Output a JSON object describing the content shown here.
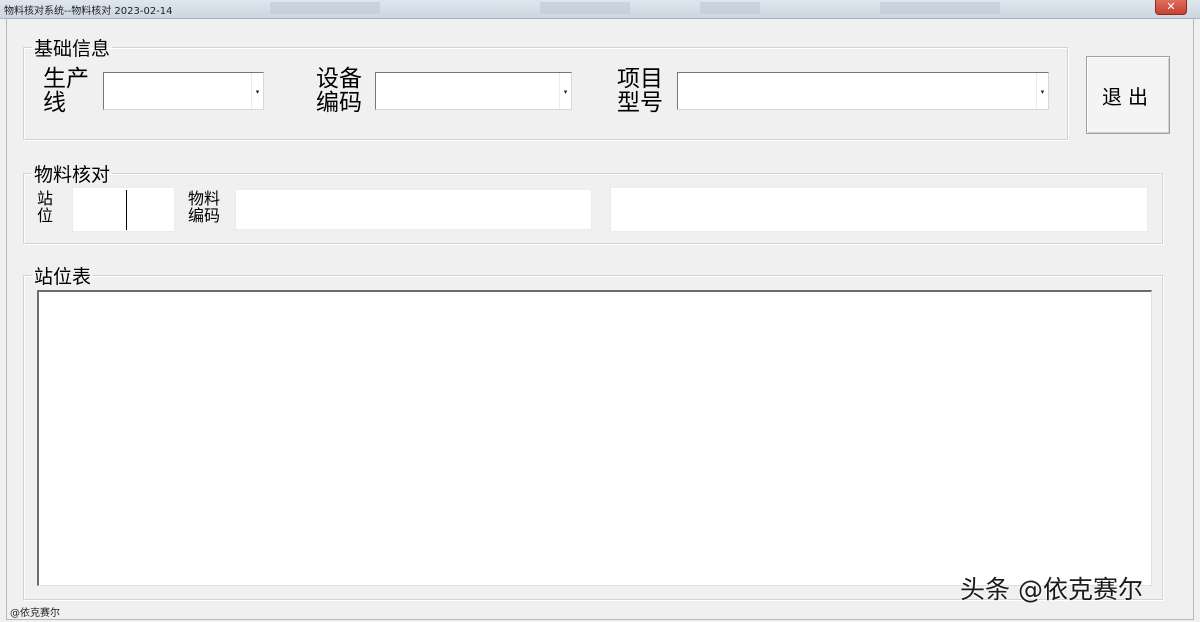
{
  "window": {
    "title": "物料核对系统--物料核对  2023-02-14",
    "close_label": "✕"
  },
  "basic_info": {
    "legend": "基础信息",
    "production_line_label": "生产\n线",
    "production_line_value": "",
    "device_code_label": "设备\n编码",
    "device_code_value": "",
    "project_model_label": "项目\n型号",
    "project_model_value": "",
    "dropdown_arrow": "▾"
  },
  "exit_button": {
    "label": "退出"
  },
  "material_check": {
    "legend": "物料核对",
    "station_label": "站\n位",
    "station_value": "",
    "material_code_label": "物料\n编码",
    "material_code_value": "",
    "result_value": ""
  },
  "station_table": {
    "legend": "站位表",
    "rows": []
  },
  "status": {
    "text": "@依克赛尔"
  },
  "watermark": {
    "text": "头条 @依克赛尔"
  }
}
